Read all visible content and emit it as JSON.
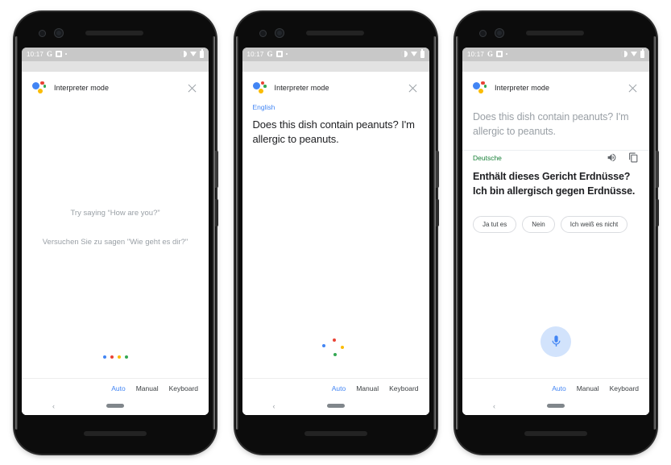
{
  "app": {
    "title": "Interpreter mode",
    "logo_icon": "google-assistant-logo",
    "close_icon": "close-icon"
  },
  "status_bar": {
    "clock": "10:17",
    "g_icon": "google-icon",
    "chip_icon": "sd-card-icon",
    "dot_icon": "dot-icon",
    "right_icons": [
      "do-not-disturb-icon",
      "wifi-icon",
      "battery-icon"
    ]
  },
  "nav": {
    "back_glyph": "‹",
    "back_icon": "back-icon",
    "pill_icon": "home-pill-icon"
  },
  "mode_bar": {
    "items": [
      {
        "label": "Auto",
        "active": true
      },
      {
        "label": "Manual",
        "active": false
      },
      {
        "label": "Keyboard",
        "active": false
      }
    ]
  },
  "phones": [
    {
      "state": "idle-listening",
      "prompts": [
        "Try saying “How are you?”",
        "Versuchen Sie zu sagen \"Wie geht es dir?\""
      ],
      "listening_indicator": "four-dots-row"
    },
    {
      "state": "english-captured",
      "language_label": "English",
      "language_color": "#4285f4",
      "transcript": "Does this dish contain peanuts? I'm allergic to peanuts.",
      "listening_indicator": "four-dots-scatter"
    },
    {
      "state": "translated",
      "source_transcript": "Does this dish contain peanuts? I'm allergic to peanuts.",
      "language_label": "Deutsche",
      "language_color": "#188038",
      "translation": "Enthält dieses Gericht Erdnüsse? Ich bin allergisch gegen Erdnüsse.",
      "actions": [
        {
          "name": "speaker-icon",
          "label": "Play translation"
        },
        {
          "name": "copy-icon",
          "label": "Copy translation"
        }
      ],
      "chips": [
        "Ja tut es",
        "Nein",
        "Ich weiß es nicht"
      ],
      "mic_icon": "microphone-icon"
    }
  ],
  "colors": {
    "google_blue": "#4285f4",
    "google_red": "#ea4335",
    "google_yellow": "#fbbc05",
    "google_green": "#34a853",
    "german_green": "#188038",
    "muted_text": "#9aa0a6",
    "mic_bg": "#d2e3fc"
  }
}
